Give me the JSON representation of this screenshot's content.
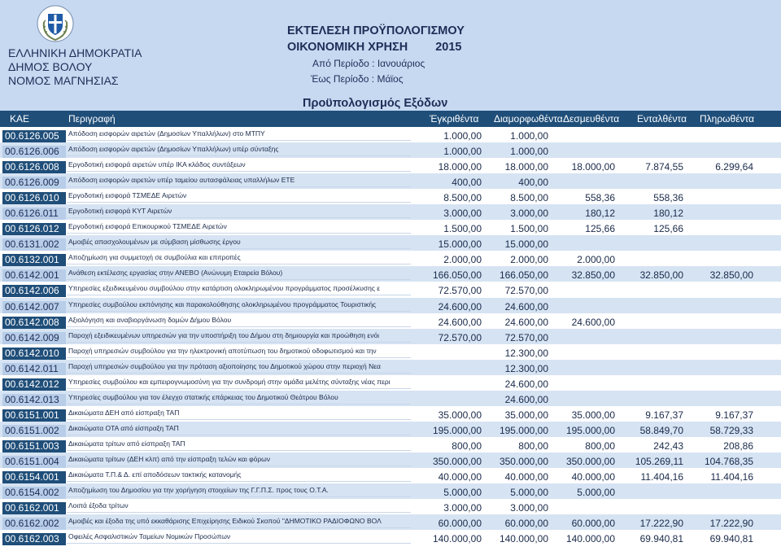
{
  "header": {
    "org": [
      "ΕΛΛΗΝΙΚΗ ΔΗΜΟΚΡΑΤΙΑ",
      "ΔΗΜΟΣ ΒΟΛΟΥ",
      "ΝΟΜΟΣ ΜΑΓΝΗΣΙΑΣ"
    ],
    "title": "ΕΚΤΕΛΕΣΗ ΠΡΟΫΠΟΛΟΓΙΣΜΟΥ",
    "fiscal_year_label": "ΟΙΚΟΝΟΜΙΚΗ ΧΡΗΣΗ",
    "fiscal_year": "2015",
    "period_from": "Από Περίοδο : Ιανουάριος",
    "period_to_label": "Έως Περίοδο :",
    "period_to_value": "Μάϊος",
    "section_title": "Προϋπολογισμός Εξόδων",
    "colors": {
      "header_bg": "#c6d9f1",
      "bar_bg": "#1f4e79",
      "row_alt": "#d6e3f3"
    }
  },
  "columns": [
    "ΚΑΕ",
    "Περιγραφή",
    "Έγκριθέντα",
    "Διαμορφωθέντα",
    "Δεσμευθέντα",
    "Ενταλθέντα",
    "Πληρωθέντα"
  ],
  "rows": [
    {
      "code": "00.6126.005",
      "desc": "Απόδοση εισφορών αιρετών (Δημοσίων Υπαλλήλων) στο ΜΤΠΥ",
      "v": [
        "1.000,00",
        "1.000,00",
        "",
        "",
        ""
      ]
    },
    {
      "code": "00.6126.006",
      "desc": "Απόδοση εισφορών αιρετών (Δημοσίων Υπαλλήλων) υπέρ σύνταξης",
      "v": [
        "1.000,00",
        "1.000,00",
        "",
        "",
        ""
      ]
    },
    {
      "code": "00.6126.008",
      "desc": "Εργοδοτική εισφορά αιρετών υπέρ ΙΚΑ κλάδος συντάξεων",
      "v": [
        "18.000,00",
        "18.000,00",
        "18.000,00",
        "7.874,55",
        "6.299,64"
      ]
    },
    {
      "code": "00.6126.009",
      "desc": "Απόδοση εισφορών αιρετών υπέρ ταμείου αυτασφάλειας υπαλλήλων ΕΤΕ",
      "v": [
        "400,00",
        "400,00",
        "",
        "",
        ""
      ]
    },
    {
      "code": "00.6126.010",
      "desc": "Εργοδοτική εισφορά ΤΣΜΕΔΕ Αιρετών",
      "v": [
        "8.500,00",
        "8.500,00",
        "558,36",
        "558,36",
        ""
      ]
    },
    {
      "code": "00.6126.011",
      "desc": "Εργοδοτική εισφορά ΚΥΤ Αιρετών",
      "v": [
        "3.000,00",
        "3.000,00",
        "180,12",
        "180,12",
        ""
      ]
    },
    {
      "code": "00.6126.012",
      "desc": "Εργοδοτική εισφορά Επικουρικού ΤΣΜΕΔΕ Αιρετών",
      "v": [
        "1.500,00",
        "1.500,00",
        "125,66",
        "125,66",
        ""
      ]
    },
    {
      "code": "00.6131.002",
      "desc": "Αμοιβές απασχολουμένων με σύμβαση μίσθωσης έργου",
      "v": [
        "15.000,00",
        "15.000,00",
        "",
        "",
        ""
      ]
    },
    {
      "code": "00.6132.001",
      "desc": "Αποζημίωση για συμμετοχή σε συμβούλια και επιτροπές",
      "v": [
        "2.000,00",
        "2.000,00",
        "2.000,00",
        "",
        ""
      ]
    },
    {
      "code": "00.6142.001",
      "desc": "Ανάθεση εκτέλεσης εργασίας στην ΑΝΕΒΟ (Ανώνυμη Εταιρεία Βόλου)",
      "v": [
        "166.050,00",
        "166.050,00",
        "32.850,00",
        "32.850,00",
        "32.850,00"
      ]
    },
    {
      "code": "00.6142.006",
      "desc": "Υπηρεσίες εξειδικευμένου συμβούλου στην κατάρτιση ολοκληρωμένου προγράμματος προσέλκυσης ε",
      "v": [
        "72.570,00",
        "72.570,00",
        "",
        "",
        ""
      ]
    },
    {
      "code": "00.6142.007",
      "desc": "Υπηρεσίες συμβούλου εκπόνησης και παρακολούθησης ολοκληρωμένου προγράμματος Τουριστικής",
      "v": [
        "24.600,00",
        "24.600,00",
        "",
        "",
        ""
      ]
    },
    {
      "code": "00.6142.008",
      "desc": "Αξιολόγηση και αναβιοργάνωση δομών Δήμου Βόλου",
      "v": [
        "24.600,00",
        "24.600,00",
        "24.600,00",
        "",
        ""
      ]
    },
    {
      "code": "00.6142.009",
      "desc": "Παροχή εξειδικευμένων υπηρεσιών για την υποστήριξη του Δήμου στη δημιουργία και προώθηση ενόι",
      "v": [
        "72.570,00",
        "72.570,00",
        "",
        "",
        ""
      ]
    },
    {
      "code": "00.6142.010",
      "desc": "Παροχή υπηρεσιών συμβούλου για την ηλεκτρονική αποτύπωση του δημοτικού οδοφωτισμού και την",
      "v": [
        "",
        "12.300,00",
        "",
        "",
        ""
      ]
    },
    {
      "code": "00.6142.011",
      "desc": "Παροχή υπηρεσιών συμβούλου για την πρόταση αξιοποίησης του Δημοτικού χώρου στην περιοχή Νεα",
      "v": [
        "",
        "12.300,00",
        "",
        "",
        ""
      ]
    },
    {
      "code": "00.6142.012",
      "desc": "Υπηρεσίες συμβούλου και εμπειρογνωμοσύνη για την συνδρομή στην ομάδα μελέτης σύνταξης νέας περι",
      "v": [
        "",
        "24.600,00",
        "",
        "",
        ""
      ]
    },
    {
      "code": "00.6142.013",
      "desc": "Υπηρεσίες συμβούλου για τον έλεγχο στατικής επάρκειας του Δημοτικού Θεάτρου Βόλου",
      "v": [
        "",
        "24.600,00",
        "",
        "",
        ""
      ]
    },
    {
      "code": "00.6151.001",
      "desc": "Δικαιώματα ΔΕΗ από είσπραξη ΤΑΠ",
      "v": [
        "35.000,00",
        "35.000,00",
        "35.000,00",
        "9.167,37",
        "9.167,37"
      ]
    },
    {
      "code": "00.6151.002",
      "desc": "Δικαιώματα ΟΤΑ από είσπραξη ΤΑΠ",
      "v": [
        "195.000,00",
        "195.000,00",
        "195.000,00",
        "58.849,70",
        "58.729,33"
      ]
    },
    {
      "code": "00.6151.003",
      "desc": "Δικαιώματα τρίτων από είσπραξη ΤΑΠ",
      "v": [
        "800,00",
        "800,00",
        "800,00",
        "242,43",
        "208,86"
      ]
    },
    {
      "code": "00.6151.004",
      "desc": "Δικαιώματα τρίτων (ΔΕΗ κλπ) από την είσπραξη τελών και φόρων",
      "v": [
        "350.000,00",
        "350.000,00",
        "350.000,00",
        "105.269,11",
        "104.768,35"
      ]
    },
    {
      "code": "00.6154.001",
      "desc": "Δικαιώματα Τ.Π.& Δ. επί αποδόσεων τακτικής κατανομής",
      "v": [
        "40.000,00",
        "40.000,00",
        "40.000,00",
        "11.404,16",
        "11.404,16"
      ]
    },
    {
      "code": "00.6154.002",
      "desc": "Αποζημίωση του Δημοσίου για την χορήγηση στοιχείων της Γ.Γ.Π.Σ. προς τους Ο.Τ.Α.",
      "v": [
        "5.000,00",
        "5.000,00",
        "5.000,00",
        "",
        ""
      ]
    },
    {
      "code": "00.6162.001",
      "desc": "Λοιπά έξοδα τρίτων",
      "v": [
        "3.000,00",
        "3.000,00",
        "",
        "",
        ""
      ]
    },
    {
      "code": "00.6162.002",
      "desc": "Αμοιβές και έξοδα της υπό εκκαθάρισης Επιχείρησης Ειδικού Σκοπού \"ΔΗΜΟΤΙΚΟ ΡΑΔΙΟΦΩΝΟ ΒΟΛ",
      "v": [
        "60.000,00",
        "60.000,00",
        "60.000,00",
        "17.222,90",
        "17.222,90"
      ]
    },
    {
      "code": "00.6162.003",
      "desc": "Οφειλές Ασφαλιστικών Ταμείων Νομικών Προσώπων",
      "v": [
        "140.000,00",
        "140.000,00",
        "140.000,00",
        "69.940,81",
        "69.940,81"
      ]
    }
  ]
}
